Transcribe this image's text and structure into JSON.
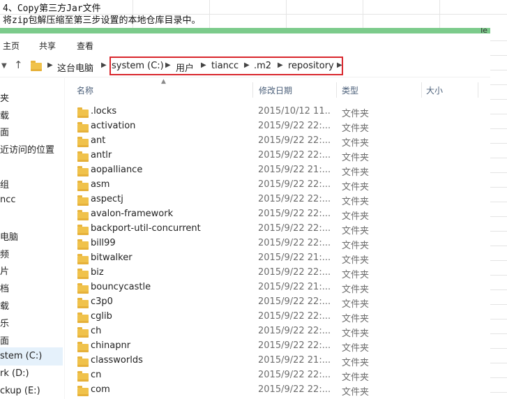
{
  "note": {
    "line1": "4、Copy第三方Jar文件",
    "line2": "将zip包解压缩至第三步设置的本地仓库目录中。"
  },
  "green_bar": {
    "right_tag": "Te"
  },
  "ribbon": {
    "tabs": [
      "主页",
      "共享",
      "查看"
    ]
  },
  "address": {
    "back_icon": "chevron-down-icon",
    "up_icon": "up-arrow-icon",
    "root": "这台电脑",
    "path": [
      "system (C:)",
      "用户",
      "tiancc",
      ".m2",
      "repository"
    ]
  },
  "navpane": {
    "items": [
      "夹",
      "载",
      "面",
      "近访问的位置",
      "组",
      "ncc",
      "电脑",
      "频",
      "片",
      "档",
      "载",
      "乐",
      "面",
      "stem (C:)",
      "rk (D:)",
      "ckup (E:)"
    ],
    "selected_index": 13
  },
  "columns": {
    "name": "名称",
    "date": "修改日期",
    "type": "类型",
    "size": "大小"
  },
  "files": [
    {
      "name": ".locks",
      "date": "2015/10/12 11...",
      "type": "文件夹"
    },
    {
      "name": "activation",
      "date": "2015/9/22 22:...",
      "type": "文件夹"
    },
    {
      "name": "ant",
      "date": "2015/9/22 22:...",
      "type": "文件夹"
    },
    {
      "name": "antlr",
      "date": "2015/9/22 22:...",
      "type": "文件夹"
    },
    {
      "name": "aopalliance",
      "date": "2015/9/22 21:...",
      "type": "文件夹"
    },
    {
      "name": "asm",
      "date": "2015/9/22 22:...",
      "type": "文件夹"
    },
    {
      "name": "aspectj",
      "date": "2015/9/22 22:...",
      "type": "文件夹"
    },
    {
      "name": "avalon-framework",
      "date": "2015/9/22 22:...",
      "type": "文件夹"
    },
    {
      "name": "backport-util-concurrent",
      "date": "2015/9/22 22:...",
      "type": "文件夹"
    },
    {
      "name": "bill99",
      "date": "2015/9/22 22:...",
      "type": "文件夹"
    },
    {
      "name": "bitwalker",
      "date": "2015/9/22 21:...",
      "type": "文件夹"
    },
    {
      "name": "biz",
      "date": "2015/9/22 22:...",
      "type": "文件夹"
    },
    {
      "name": "bouncycastle",
      "date": "2015/9/22 21:...",
      "type": "文件夹"
    },
    {
      "name": "c3p0",
      "date": "2015/9/22 22:...",
      "type": "文件夹"
    },
    {
      "name": "cglib",
      "date": "2015/9/22 22:...",
      "type": "文件夹"
    },
    {
      "name": "ch",
      "date": "2015/9/22 22:...",
      "type": "文件夹"
    },
    {
      "name": "chinapnr",
      "date": "2015/9/22 22:...",
      "type": "文件夹"
    },
    {
      "name": "classworlds",
      "date": "2015/9/22 21:...",
      "type": "文件夹"
    },
    {
      "name": "cn",
      "date": "2015/9/22 22:...",
      "type": "文件夹"
    },
    {
      "name": "com",
      "date": "2015/9/22 22:...",
      "type": "文件夹"
    }
  ],
  "colors": {
    "accent_green": "#7ccb8b",
    "highlight_red": "#d9262c",
    "folder": "#f0c24b"
  }
}
